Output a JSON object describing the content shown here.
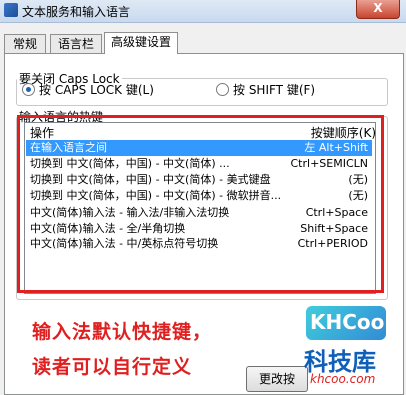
{
  "window": {
    "title": "文本服务和输入语言",
    "close_label": "X"
  },
  "tabs": [
    {
      "label": "常规"
    },
    {
      "label": "语言栏"
    },
    {
      "label": "高级键设置"
    }
  ],
  "caps_lock": {
    "legend": "要关闭 Caps Lock",
    "option_caps": "按 CAPS LOCK 键(L)",
    "option_shift": "按 SHIFT 键(F)",
    "selected": "caps"
  },
  "hotkeys": {
    "legend": "输入语言的热键",
    "col_action": "操作",
    "col_keys": "按键顺序(K)",
    "rows": [
      {
        "action": "在输入语言之间",
        "keys": "左 Alt+Shift"
      },
      {
        "action": "切换到 中文(简体，中国) - 中文(简体) ...",
        "keys": "Ctrl+SEMICLN"
      },
      {
        "action": "切换到 中文(简体，中国) - 中文(简体) - 美式键盘",
        "keys": "(无)"
      },
      {
        "action": "切换到 中文(简体，中国) - 中文(简体) - 微软拼音...",
        "keys": "(无)"
      },
      {
        "action": "中文(简体)输入法 - 输入法/非输入法切换",
        "keys": "Ctrl+Space"
      },
      {
        "action": "中文(简体)输入法 - 全/半角切换",
        "keys": "Shift+Space"
      },
      {
        "action": "中文(简体)输入法 - 中/英标点符号切换",
        "keys": "Ctrl+PERIOD"
      }
    ]
  },
  "annotation": {
    "line1": "输入法默认快捷键，",
    "line2": "读者可以自行定义",
    "color": "#e02020"
  },
  "buttons": {
    "change_keys": "更改按"
  },
  "watermark": {
    "logo": "KHCoo",
    "name": "科技库",
    "url": "khcoo.com"
  }
}
